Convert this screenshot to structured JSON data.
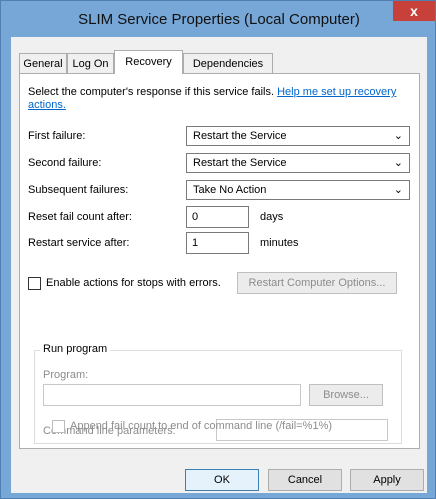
{
  "window": {
    "title": "SLIM Service Properties (Local Computer)",
    "close_glyph": "x"
  },
  "tabs": [
    "General",
    "Log On",
    "Recovery",
    "Dependencies"
  ],
  "intro": {
    "text": "Select the computer's response if this service fails.",
    "link_line1": "Help me set up recovery",
    "link_line2": "actions."
  },
  "failures": [
    {
      "label": "First failure:",
      "value": "Restart the Service"
    },
    {
      "label": "Second failure:",
      "value": "Restart the Service"
    },
    {
      "label": "Subsequent failures:",
      "value": "Take No Action"
    }
  ],
  "reset": {
    "label": "Reset fail count after:",
    "value": "0",
    "unit": "days"
  },
  "restart": {
    "label": "Restart service after:",
    "value": "1",
    "unit": "minutes"
  },
  "enable_actions": {
    "label": "Enable actions for stops with errors.",
    "checked": false
  },
  "restart_computer_button": "Restart Computer Options...",
  "run_program": {
    "legend": "Run program",
    "program_label": "Program:",
    "program_value": "",
    "browse_button": "Browse...",
    "cmd_label": "Command line parameters:",
    "cmd_value": "",
    "append_label": "Append fail count to end of command line (/fail=%1%)"
  },
  "buttons": {
    "ok": "OK",
    "cancel": "Cancel",
    "apply": "Apply"
  },
  "colors": {
    "titlebar": "#77a7d6",
    "close": "#c7403a",
    "link": "#0066cc"
  }
}
